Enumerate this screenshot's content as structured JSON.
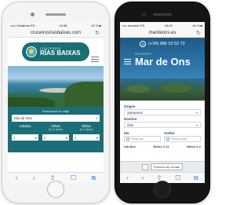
{
  "left_phone": {
    "status": {
      "carrier": "••••• Vodafone ES",
      "time": "18:38",
      "battery": "42 % ■"
    },
    "address": "cruceirosriasbaixas.com",
    "logo": {
      "top": "CRUCEIROS",
      "bottom": "RÍAS BAIXAS"
    },
    "form": {
      "heading": "Seleccione su viaje",
      "trip_value": "Isla de Ons",
      "adults_label": "Adultos",
      "children_label": "Niños",
      "children_range": "(2-12 años)",
      "kids_label": "Niños",
      "kids_range": "(0-2 años)",
      "adults_value": "2",
      "children_value": "0",
      "kids_value": "0"
    }
  },
  "right_phone": {
    "status": {
      "carrier": "•••• movistar ES",
      "time": "18:00",
      "battery": "44 % ■"
    },
    "address": "mardeons.es",
    "phone_number": "(+34) 986 22 52 72",
    "brand": {
      "top": "NAVIERA",
      "name": "Mar de Ons"
    },
    "form": {
      "origin_label": "Origen",
      "origin_value": "Sanxenxo",
      "dest_label": "Destino",
      "dest_value": "Ons",
      "ida_label": "Ida",
      "vuelta_label": "Vuelta",
      "ida_placeholder": "Fecha ida",
      "vuelta_placeholder": "Fecha vuelta",
      "adults_label": "Adultos",
      "children_label": "Niños 3-12",
      "kids_label": "Niños 0-2",
      "picker_label": "Próxima de contas"
    }
  },
  "icons": {
    "back": "‹",
    "forward": "›",
    "share": "⇧",
    "bookmarks": "☐",
    "tabs": "⧉",
    "reload": "↻",
    "caret": "▾",
    "phone": "✆"
  },
  "colors": {
    "teal": "#1b6e78",
    "navy": "#2a4f74",
    "accent_green": "#8be08e"
  }
}
